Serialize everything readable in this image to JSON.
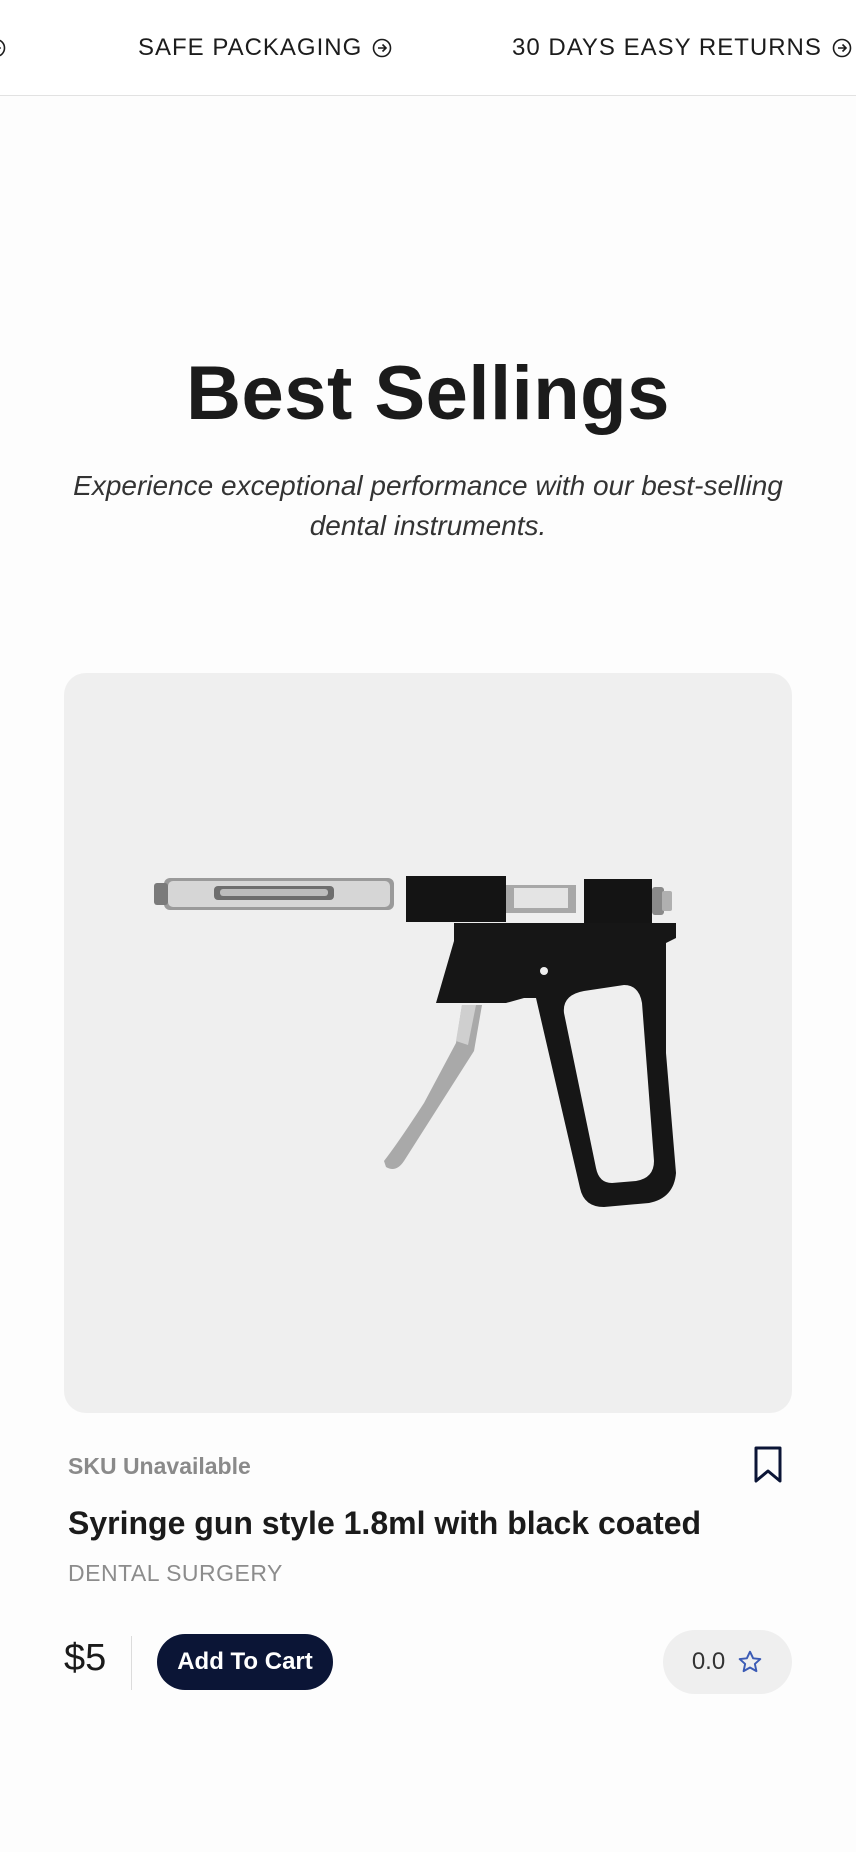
{
  "marquee": {
    "items": [
      {
        "label": "SAFE PACKAGING"
      },
      {
        "label": "30 DAYS EASY RETURNS"
      }
    ]
  },
  "section": {
    "title": "Best Sellings",
    "subtitle": "Experience exceptional performance with our best-selling dental instruments."
  },
  "product": {
    "sku": "SKU Unavailable",
    "name": "Syringe gun style 1.8ml with black coated",
    "category": "DENTAL SURGERY",
    "price": "$5",
    "add_to_cart_label": "Add To Cart",
    "rating": "0.0",
    "icons": {
      "bookmark": "bookmark-icon",
      "star": "star-icon",
      "circle_arrow": "circle-arrow-right-icon"
    }
  },
  "colors": {
    "primary_button": "#0b1536",
    "star": "#3b5bb5"
  }
}
